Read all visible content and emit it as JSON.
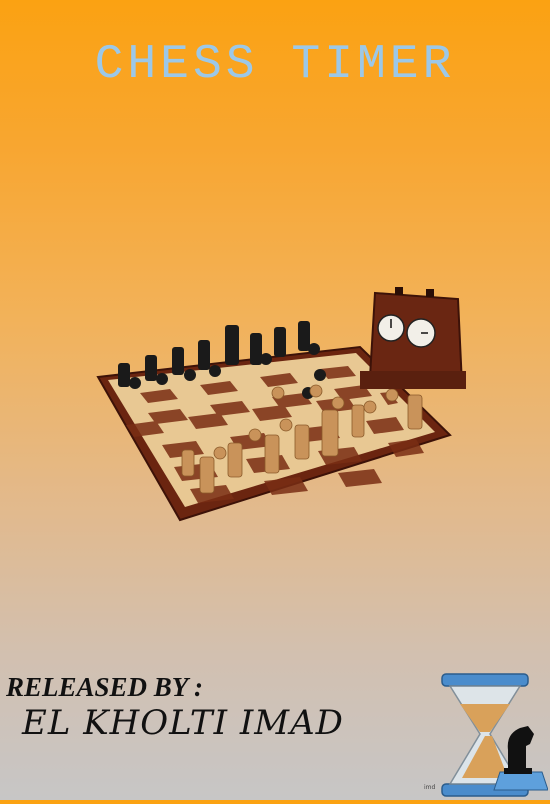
{
  "app": {
    "title": "CHESS TIMER"
  },
  "credits": {
    "line1": "RELEASED BY :",
    "line2": "EL KHOLTI IMAD"
  },
  "logo": {
    "signature": "imd"
  },
  "icons": {
    "hero": "chessboard-with-clock-icon",
    "logo": "hourglass-knight-icon"
  },
  "colors": {
    "background_top": "#fba212",
    "background_bottom": "#c7c6c6",
    "title": "#9cc8e8",
    "board_frame": "#6b2510",
    "light_square": "#e8c893",
    "dark_square": "#7a2e14"
  }
}
